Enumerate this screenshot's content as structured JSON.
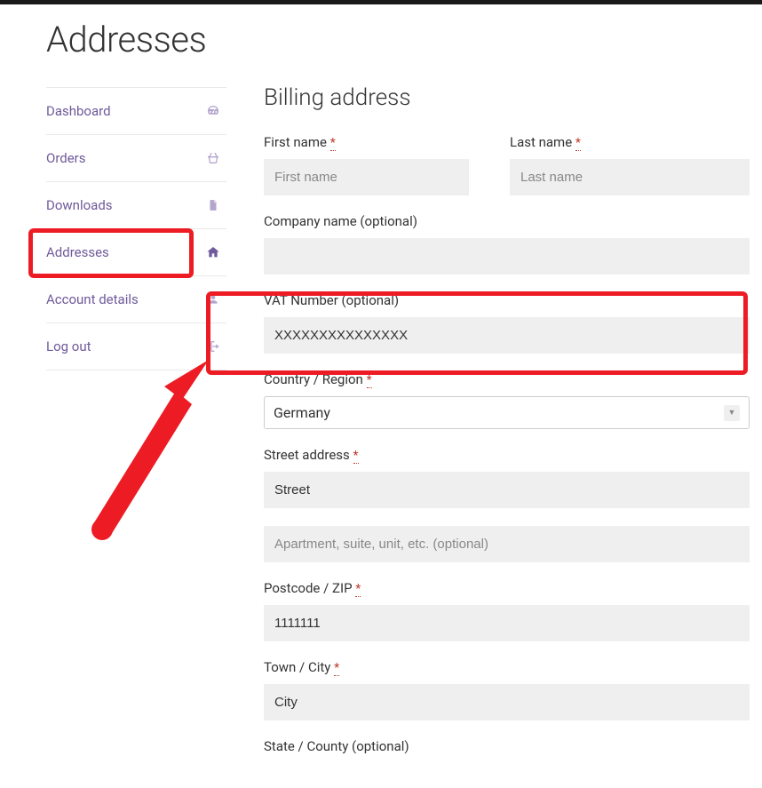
{
  "page_title": "Addresses",
  "sidebar": {
    "items": [
      {
        "label": "Dashboard"
      },
      {
        "label": "Orders"
      },
      {
        "label": "Downloads"
      },
      {
        "label": "Addresses"
      },
      {
        "label": "Account details"
      },
      {
        "label": "Log out"
      }
    ]
  },
  "form": {
    "heading": "Billing address",
    "first_name": {
      "label": "First name",
      "placeholder": "First name",
      "value": ""
    },
    "last_name": {
      "label": "Last name",
      "placeholder": "Last name",
      "value": ""
    },
    "company": {
      "label": "Company name (optional)",
      "value": ""
    },
    "vat": {
      "label": "VAT Number (optional)",
      "value": "XXXXXXXXXXXXXXX"
    },
    "country": {
      "label": "Country / Region",
      "value": "Germany"
    },
    "street": {
      "label": "Street address",
      "value": "Street",
      "placeholder2": "Apartment, suite, unit, etc. (optional)"
    },
    "postcode": {
      "label": "Postcode / ZIP",
      "value": "1111111"
    },
    "city": {
      "label": "Town / City",
      "value": "City"
    },
    "state": {
      "label": "State / County (optional)"
    }
  },
  "required_marker": "*"
}
